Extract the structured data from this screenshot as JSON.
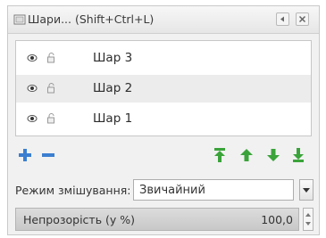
{
  "window": {
    "title": "Шари... (Shift+Ctrl+L)"
  },
  "layers": [
    {
      "name": "Шар 3",
      "visible": true,
      "locked": false,
      "selected": false
    },
    {
      "name": "Шар 2",
      "visible": true,
      "locked": false,
      "selected": true
    },
    {
      "name": "Шар 1",
      "visible": true,
      "locked": false,
      "selected": false
    }
  ],
  "icons": {
    "add": "plus-icon",
    "remove": "minus-icon",
    "raise_top": "raise-to-top-icon",
    "raise": "raise-icon",
    "lower": "lower-icon",
    "lower_bottom": "lower-to-bottom-icon"
  },
  "colors": {
    "add": "#3b7fd0",
    "remove": "#3b7fd0",
    "arrows": "#3aa33a"
  },
  "blend": {
    "label": "Режим змішування:",
    "value": "Звичайний"
  },
  "opacity": {
    "label": "Непрозорість (у %)",
    "value_text": "100,0",
    "percent": 100
  }
}
